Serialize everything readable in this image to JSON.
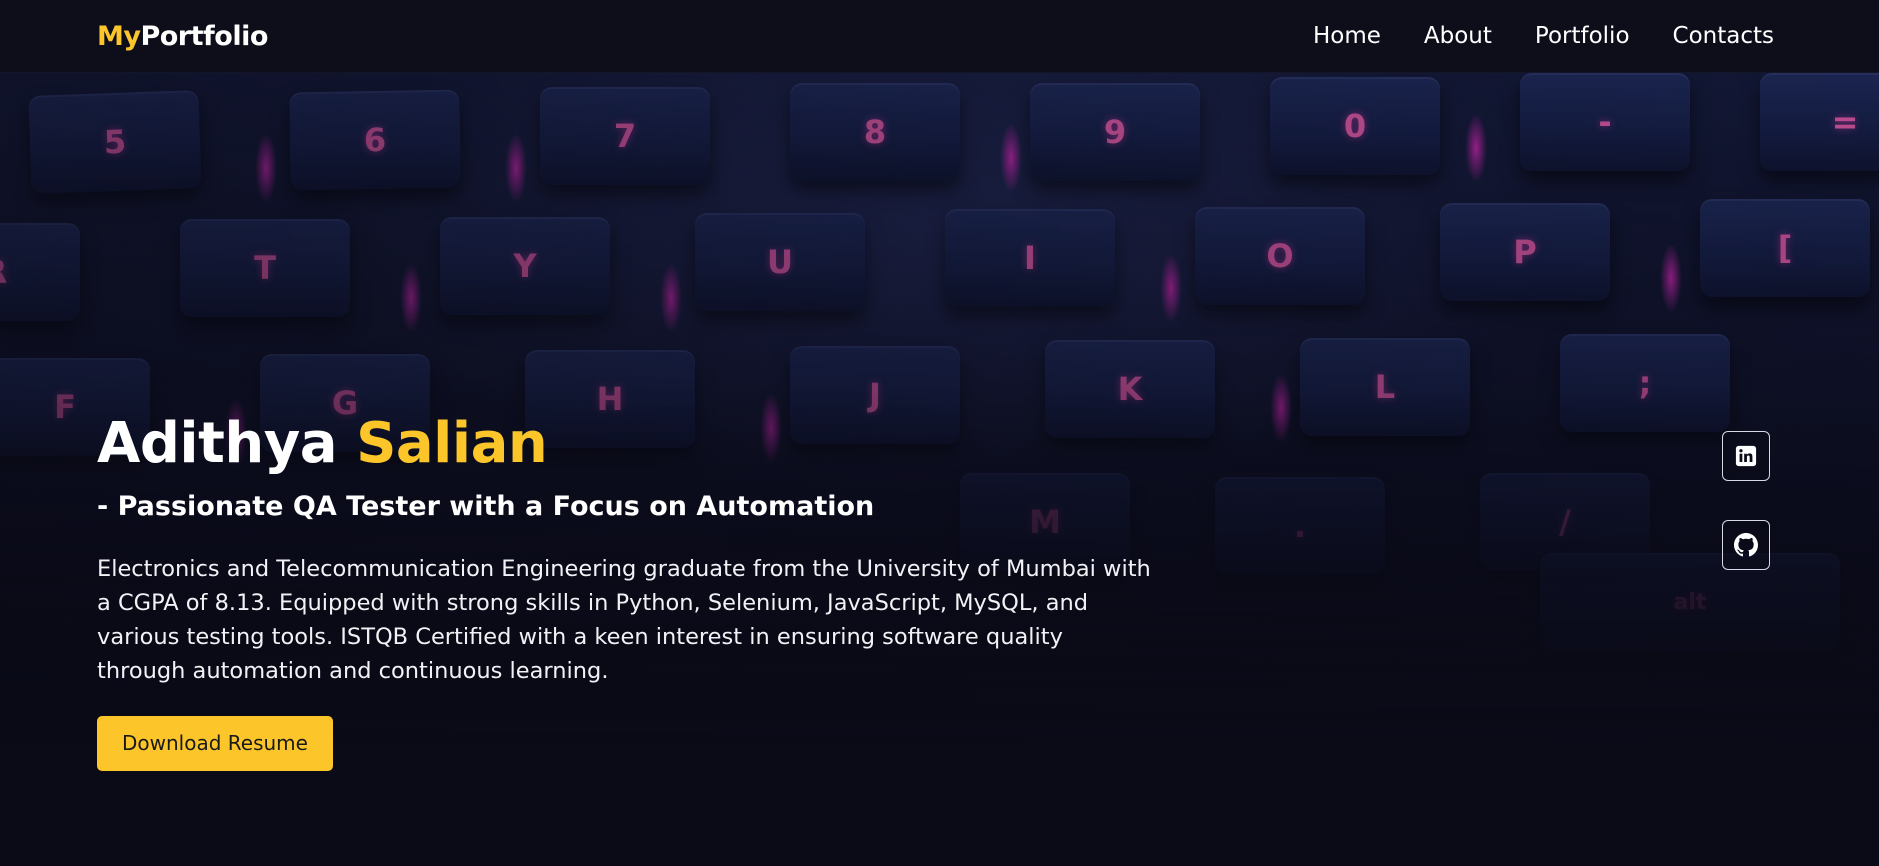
{
  "brand": {
    "accent": "My",
    "rest": "Portfolio"
  },
  "nav": {
    "items": [
      {
        "label": "Home"
      },
      {
        "label": "About"
      },
      {
        "label": "Portfolio"
      },
      {
        "label": "Contacts"
      }
    ]
  },
  "hero": {
    "first_name": "Adithya",
    "last_name": "Salian",
    "tagline": "- Passionate QA Tester with a Focus on Automation",
    "description": "Electronics and Telecommunication Engineering graduate from the University of Mumbai with a CGPA of 8.13. Equipped with strong skills in Python, Selenium, JavaScript, MySQL, and various testing tools. ISTQB Certified with a keen interest in ensuring software quality through automation and continuous learning.",
    "button_label": "Download Resume"
  },
  "keyboard": {
    "row1": [
      "5",
      "6",
      "7",
      "8",
      "9",
      "0",
      "-",
      "="
    ],
    "row2": [
      "R",
      "T",
      "Y",
      "U",
      "I",
      "O",
      "P",
      "["
    ],
    "row3": [
      "F",
      "G",
      "H",
      "J",
      "K",
      "L",
      ";"
    ],
    "row4": [
      "M",
      ".",
      "/",
      "alt"
    ]
  },
  "social": [
    {
      "icon": "linkedin-icon"
    },
    {
      "icon": "github-icon"
    }
  ],
  "colors": {
    "accent": "#fcc62b",
    "background": "#0b0b18",
    "navbar": "#0e0e1b",
    "key_legend": "#e05aa8"
  }
}
